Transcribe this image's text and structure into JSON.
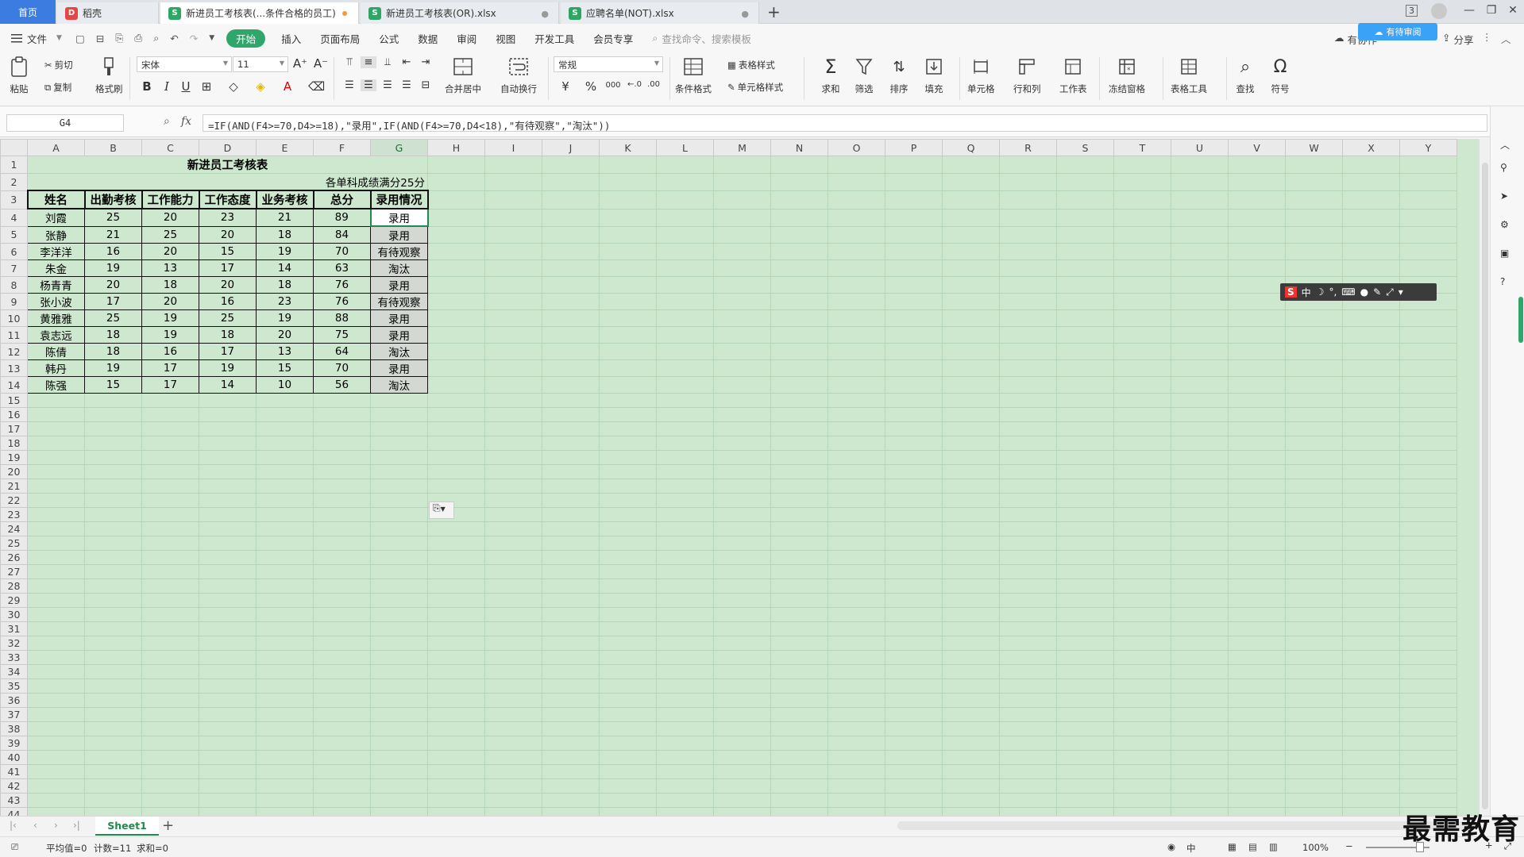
{
  "tabs": {
    "home": "首页",
    "items": [
      {
        "label": "稻壳",
        "type": "daoke"
      },
      {
        "label": "新进员工考核表(...条件合格的员工)",
        "type": "sheet",
        "active": true,
        "modified": true
      },
      {
        "label": "新进员工考核表(OR).xlsx",
        "type": "sheet"
      },
      {
        "label": "应聘名单(NOT).xlsx",
        "type": "sheet"
      }
    ],
    "add": "+",
    "tab_count_badge": "3"
  },
  "menu": {
    "file": "文件",
    "items": [
      "开始",
      "插入",
      "页面布局",
      "公式",
      "数据",
      "审阅",
      "视图",
      "开发工具",
      "会员专享"
    ],
    "active_index": 0,
    "search_placeholder": "查找命令、搜索模板",
    "cloud_badge": "有待审阅",
    "sync_label": "有协作",
    "share": "分享"
  },
  "ribbon": {
    "paste": "粘贴",
    "cut": "剪切",
    "copy": "复制",
    "format_painter": "格式刷",
    "font_name": "宋体",
    "font_size": "11",
    "number_format": "常规",
    "merge_center": "合并居中",
    "wrap_text": "自动换行",
    "conditional_format": "条件格式",
    "table_style": "表格样式",
    "cell_style": "单元格样式",
    "sum": "求和",
    "filter": "筛选",
    "sort": "排序",
    "fill": "填充",
    "cells": "单元格",
    "rows_cols": "行和列",
    "worksheet": "工作表",
    "freeze": "冻结窗格",
    "table_tools": "表格工具",
    "find": "查找",
    "symbol": "符号",
    "currency": "¥",
    "percent": "%",
    "thousands": "000"
  },
  "formula_bar": {
    "name_box": "G4",
    "fx": "fx",
    "formula": "=IF(AND(F4>=70,D4>=18),\"录用\",IF(AND(F4>=70,D4<18),\"有待观察\",\"淘汰\"))"
  },
  "sheet": {
    "columns": [
      "A",
      "B",
      "C",
      "D",
      "E",
      "F",
      "G",
      "H",
      "I",
      "J",
      "K",
      "L",
      "M",
      "N",
      "O",
      "P",
      "Q",
      "R",
      "S",
      "T",
      "U",
      "V",
      "W",
      "X",
      "Y"
    ],
    "selected_column": "G",
    "title": "新进员工考核表",
    "note": "各单科成绩满分25分",
    "headers": [
      "姓名",
      "出勤考核",
      "工作能力",
      "工作态度",
      "业务考核",
      "总分",
      "录用情况"
    ],
    "rows": [
      [
        "刘霞",
        "25",
        "20",
        "23",
        "21",
        "89",
        "录用"
      ],
      [
        "张静",
        "21",
        "25",
        "20",
        "18",
        "84",
        "录用"
      ],
      [
        "李洋洋",
        "16",
        "20",
        "15",
        "19",
        "70",
        "有待观察"
      ],
      [
        "朱金",
        "19",
        "13",
        "17",
        "14",
        "63",
        "淘汰"
      ],
      [
        "杨青青",
        "20",
        "18",
        "20",
        "18",
        "76",
        "录用"
      ],
      [
        "张小波",
        "17",
        "20",
        "16",
        "23",
        "76",
        "有待观察"
      ],
      [
        "黄雅雅",
        "25",
        "19",
        "25",
        "19",
        "88",
        "录用"
      ],
      [
        "袁志远",
        "18",
        "19",
        "18",
        "20",
        "75",
        "录用"
      ],
      [
        "陈倩",
        "18",
        "16",
        "17",
        "13",
        "64",
        "淘汰"
      ],
      [
        "韩丹",
        "19",
        "17",
        "19",
        "15",
        "70",
        "录用"
      ],
      [
        "陈强",
        "15",
        "17",
        "14",
        "10",
        "56",
        "淘汰"
      ]
    ],
    "total_rows": 46
  },
  "sheet_tabs": {
    "active": "Sheet1",
    "add": "+"
  },
  "status": {
    "average": "平均值=0",
    "count": "计数=11",
    "sum": "求和=0",
    "zoom": "100%",
    "ime_lang": "中"
  },
  "ime_bar": {
    "logo": "S",
    "lang": "中"
  },
  "watermark": "最需教育",
  "colors": {
    "accent": "#2fa76a",
    "sheet_bg": "#cde8cf",
    "home_tab": "#3c7be0"
  }
}
